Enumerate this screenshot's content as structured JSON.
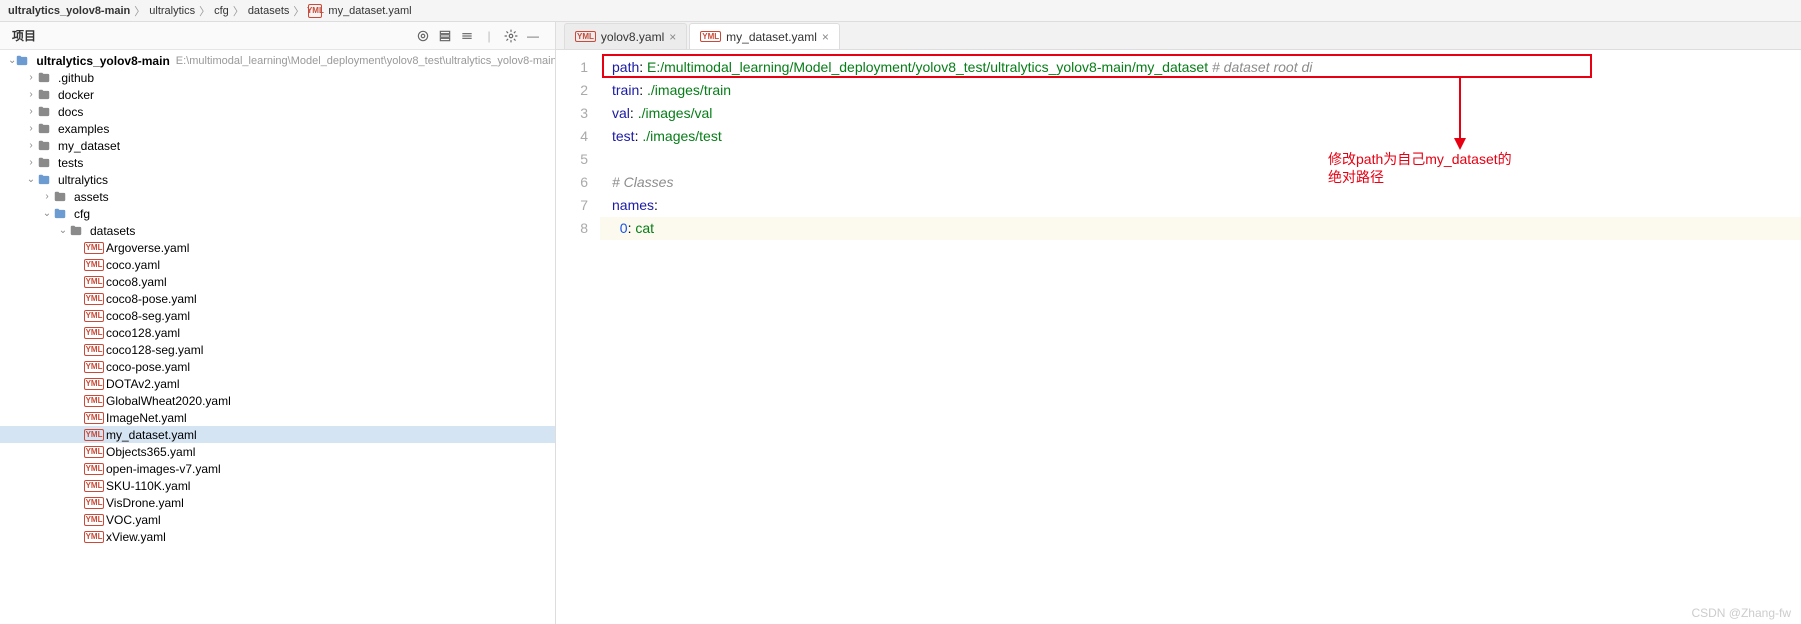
{
  "breadcrumb": {
    "project": "ultralytics_yolov8-main",
    "parts": [
      "ultralytics",
      "cfg",
      "datasets"
    ],
    "file": "my_dataset.yaml"
  },
  "panel": {
    "title": "项目"
  },
  "tree": {
    "root": {
      "name": "ultralytics_yolov8-main",
      "hint": "E:\\multimodal_learning\\Model_deployment\\yolov8_test\\ultralytics_yolov8-main"
    },
    "top_folders": [
      {
        "name": ".github"
      },
      {
        "name": "docker"
      },
      {
        "name": "docs"
      },
      {
        "name": "examples"
      },
      {
        "name": "my_dataset"
      },
      {
        "name": "tests"
      }
    ],
    "ultralytics": "ultralytics",
    "assets": "assets",
    "cfg": "cfg",
    "datasets": "datasets",
    "yaml_files": [
      "Argoverse.yaml",
      "coco.yaml",
      "coco8.yaml",
      "coco8-pose.yaml",
      "coco8-seg.yaml",
      "coco128.yaml",
      "coco128-seg.yaml",
      "coco-pose.yaml",
      "DOTAv2.yaml",
      "GlobalWheat2020.yaml",
      "ImageNet.yaml",
      "my_dataset.yaml",
      "Objects365.yaml",
      "open-images-v7.yaml",
      "SKU-110K.yaml",
      "VisDrone.yaml",
      "VOC.yaml",
      "xView.yaml"
    ],
    "selected": "my_dataset.yaml"
  },
  "tabs": [
    {
      "label": "yolov8.yaml",
      "active": false
    },
    {
      "label": "my_dataset.yaml",
      "active": true
    }
  ],
  "code": {
    "lines": [
      {
        "segments": [
          {
            "t": "key",
            "v": "path"
          },
          {
            "t": "plain",
            "v": ": "
          },
          {
            "t": "str",
            "v": "E:/multimodal_learning/Model_deployment/yolov8_test/ultralytics_yolov8-main/my_dataset"
          },
          {
            "t": "plain",
            "v": " "
          },
          {
            "t": "comment",
            "v": "# dataset root di"
          }
        ]
      },
      {
        "segments": [
          {
            "t": "key",
            "v": "train"
          },
          {
            "t": "plain",
            "v": ": "
          },
          {
            "t": "str",
            "v": "./images/train"
          }
        ]
      },
      {
        "segments": [
          {
            "t": "key",
            "v": "val"
          },
          {
            "t": "plain",
            "v": ": "
          },
          {
            "t": "str",
            "v": "./images/val"
          }
        ]
      },
      {
        "segments": [
          {
            "t": "key",
            "v": "test"
          },
          {
            "t": "plain",
            "v": ": "
          },
          {
            "t": "str",
            "v": "./images/test"
          }
        ]
      },
      {
        "segments": [
          {
            "t": "plain",
            "v": ""
          }
        ]
      },
      {
        "segments": [
          {
            "t": "comment",
            "v": "# Classes"
          }
        ]
      },
      {
        "segments": [
          {
            "t": "key",
            "v": "names"
          },
          {
            "t": "plain",
            "v": ":"
          }
        ]
      },
      {
        "segments": [
          {
            "t": "plain",
            "v": "  "
          },
          {
            "t": "num",
            "v": "0"
          },
          {
            "t": "plain",
            "v": ": "
          },
          {
            "t": "str",
            "v": "cat"
          }
        ]
      }
    ],
    "current_line_index": 7
  },
  "annotation": {
    "line1": "修改path为自己my_dataset的",
    "line2": "绝对路径"
  },
  "watermark": "CSDN @Zhang-fw"
}
